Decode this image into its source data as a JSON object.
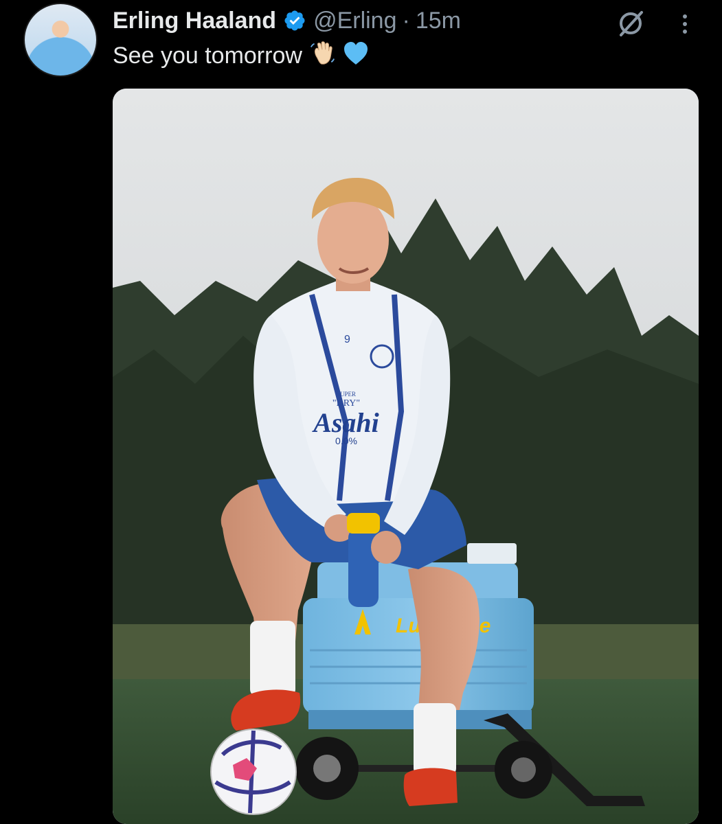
{
  "tweet": {
    "author_name": "Erling Haaland",
    "handle": "@Erling",
    "separator": "·",
    "timestamp": "15m",
    "text": "See you tomorrow",
    "emojis": [
      "waving-hand",
      "light-blue-heart"
    ],
    "verified_color": "#1d9bf0",
    "icons": {
      "grok": "grok-icon",
      "more": "more-vertical-icon",
      "verified": "verified-badge-icon"
    }
  },
  "photo": {
    "jersey_number": "9",
    "sponsor_small": "SUPER",
    "sponsor_mid": "\"DRY\"",
    "sponsor_main": "Asahi",
    "sponsor_sub": "0.0%",
    "cooler_brand": "Lucozade"
  }
}
